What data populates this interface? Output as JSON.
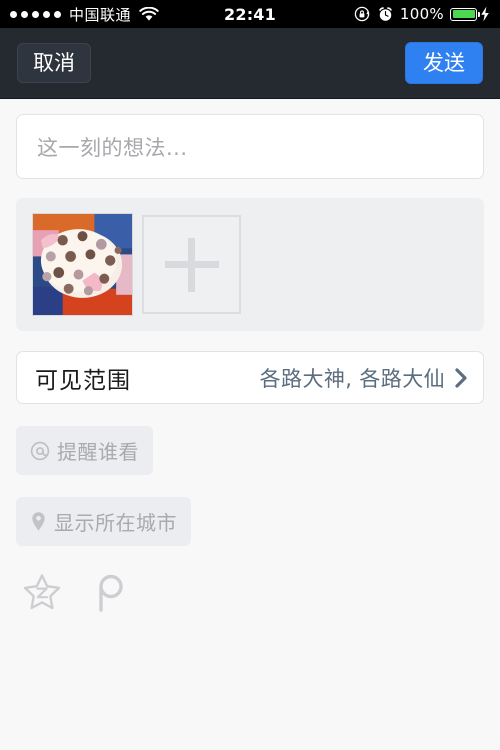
{
  "statusbar": {
    "signal_dots": 5,
    "carrier": "中国联通",
    "wifi_icon": "wifi-icon",
    "time": "22:41",
    "rotation_lock_icon": "rotation-lock-icon",
    "alarm_icon": "alarm-clock-icon",
    "battery_percent": "100%",
    "battery_level": 100,
    "charging_icon": "charging-bolt-icon",
    "battery_color": "#4cd750",
    "background": "#000000"
  },
  "navbar": {
    "cancel_label": "取消",
    "send_label": "发送",
    "background": "#252a31",
    "send_color": "#2f81f2"
  },
  "compose": {
    "placeholder": "这一刻的想法...",
    "value": ""
  },
  "photos": {
    "selected": [
      {
        "name": "polka-dot-plush-pillow-photo"
      }
    ],
    "add_icon": "plus-icon",
    "panel_background": "#eeeff1"
  },
  "visibility": {
    "label": "可见范围",
    "value": "各路大神, 各路大仙",
    "chevron_icon": "chevron-right-icon",
    "value_color": "#5b6e80"
  },
  "options": [
    {
      "icon": "at-mention-icon",
      "label": "提醒谁看"
    },
    {
      "icon": "location-pin-icon",
      "label": "显示所在城市"
    }
  ],
  "share_targets": [
    {
      "icon": "qzone-star-icon",
      "name": "qzone"
    },
    {
      "icon": "pengyou-p-icon",
      "name": "pengyou"
    }
  ],
  "page": {
    "background": "#f8f8f9"
  }
}
